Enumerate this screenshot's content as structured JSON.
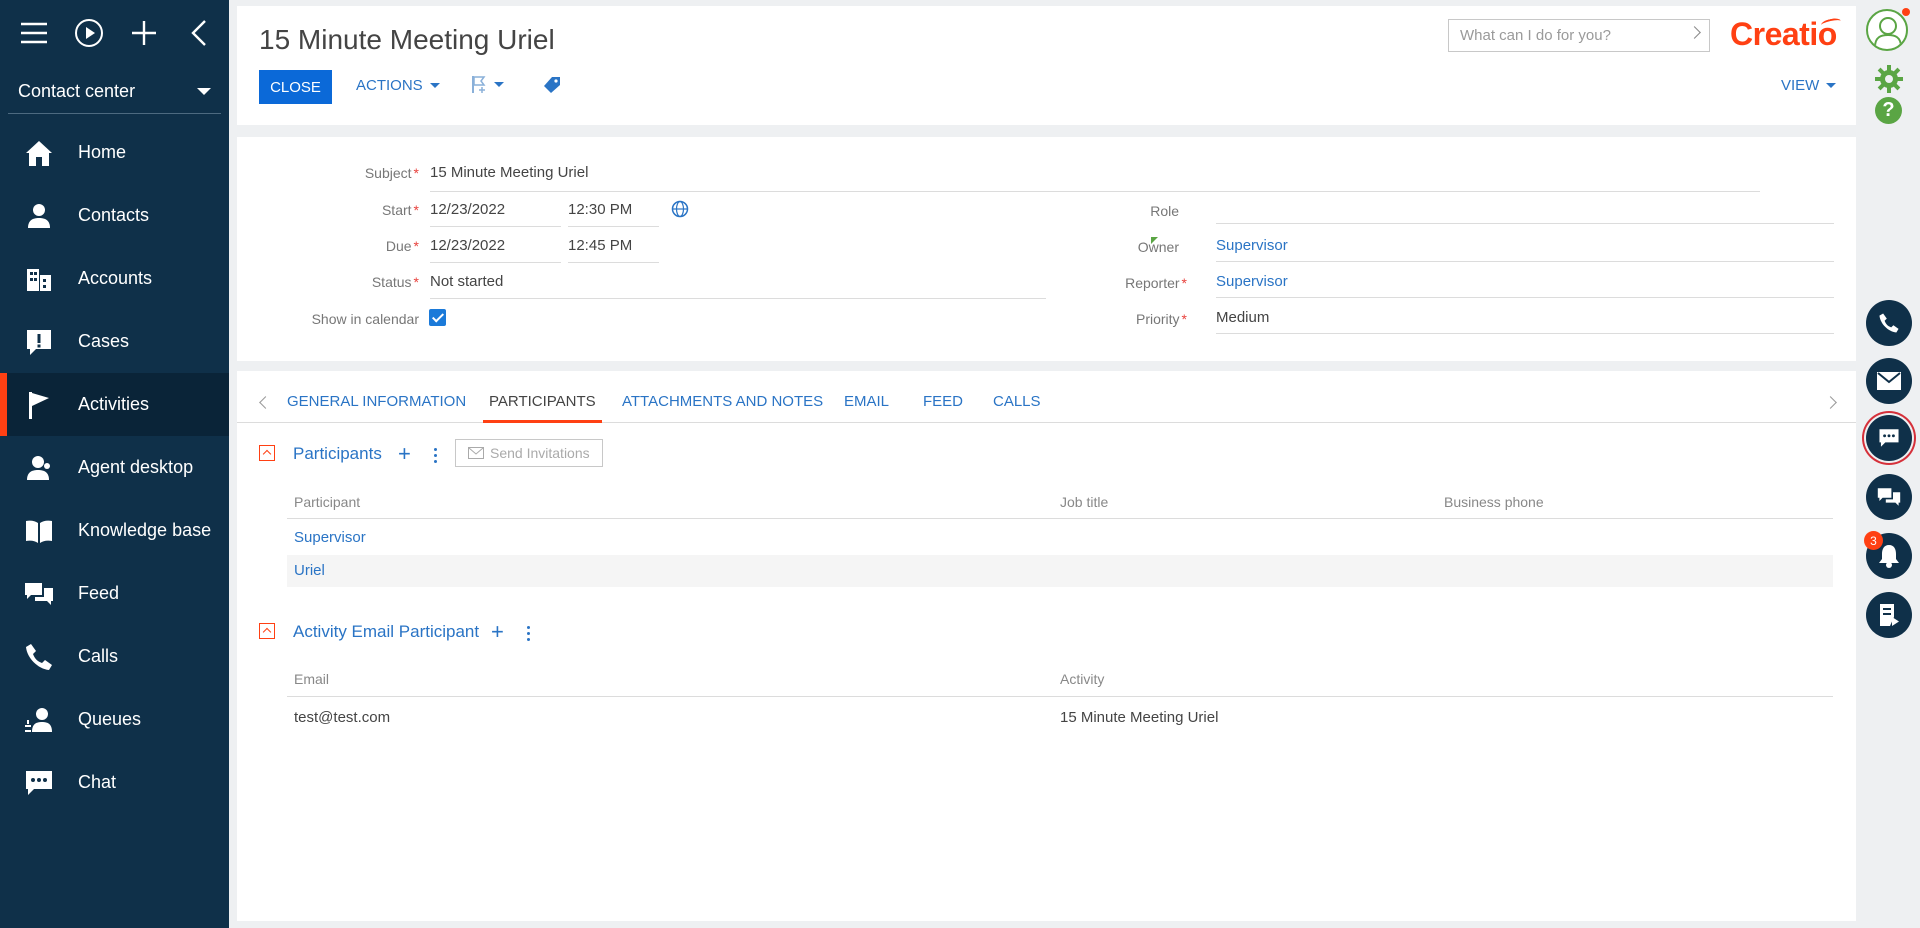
{
  "sidebar": {
    "workspace": "Contact center",
    "items": [
      {
        "label": "Home",
        "icon": "home-icon"
      },
      {
        "label": "Contacts",
        "icon": "person-icon"
      },
      {
        "label": "Accounts",
        "icon": "building-icon"
      },
      {
        "label": "Cases",
        "icon": "exclamation-icon"
      },
      {
        "label": "Activities",
        "icon": "flag-icon",
        "active": true
      },
      {
        "label": "Agent desktop",
        "icon": "headset-person-icon"
      },
      {
        "label": "Knowledge base",
        "icon": "book-icon"
      },
      {
        "label": "Feed",
        "icon": "chat-bubbles-icon"
      },
      {
        "label": "Calls",
        "icon": "phone-icon"
      },
      {
        "label": "Queues",
        "icon": "queue-icon"
      },
      {
        "label": "Chat",
        "icon": "chat-icon"
      }
    ]
  },
  "header": {
    "title": "15 Minute Meeting Uriel",
    "search_placeholder": "What can I do for you?",
    "logo": "Creatio",
    "close_label": "CLOSE",
    "actions_label": "ACTIONS",
    "view_label": "VIEW"
  },
  "fields": {
    "subject_label": "Subject",
    "subject_value": "15 Minute Meeting Uriel",
    "start_label": "Start",
    "start_date": "12/23/2022",
    "start_time": "12:30 PM",
    "due_label": "Due",
    "due_date": "12/23/2022",
    "due_time": "12:45 PM",
    "status_label": "Status",
    "status_value": "Not started",
    "calendar_label": "Show in calendar",
    "role_label": "Role",
    "owner_label": "Owner",
    "owner_value": "Supervisor",
    "reporter_label": "Reporter",
    "reporter_value": "Supervisor",
    "priority_label": "Priority",
    "priority_value": "Medium",
    "required_mark": "*"
  },
  "tabs": [
    "GENERAL INFORMATION",
    "PARTICIPANTS",
    "ATTACHMENTS AND NOTES",
    "EMAIL",
    "FEED",
    "CALLS"
  ],
  "participants": {
    "title": "Participants",
    "invite_label": "Send Invitations",
    "columns": [
      "Participant",
      "Job title",
      "Business phone"
    ],
    "rows": [
      "Supervisor",
      "Uriel"
    ]
  },
  "email_participants": {
    "title": "Activity Email Participant",
    "columns": [
      "Email",
      "Activity"
    ],
    "rows": [
      {
        "email": "test@test.com",
        "activity": "15 Minute Meeting Uriel"
      }
    ]
  },
  "rail": {
    "notification_count": "3",
    "help_label": "?"
  },
  "colors": {
    "sidebar_bg": "#0f3049",
    "accent": "#ff4013",
    "primary_button": "#0b69d8",
    "link": "#2a74c5",
    "success": "#5aa544"
  }
}
